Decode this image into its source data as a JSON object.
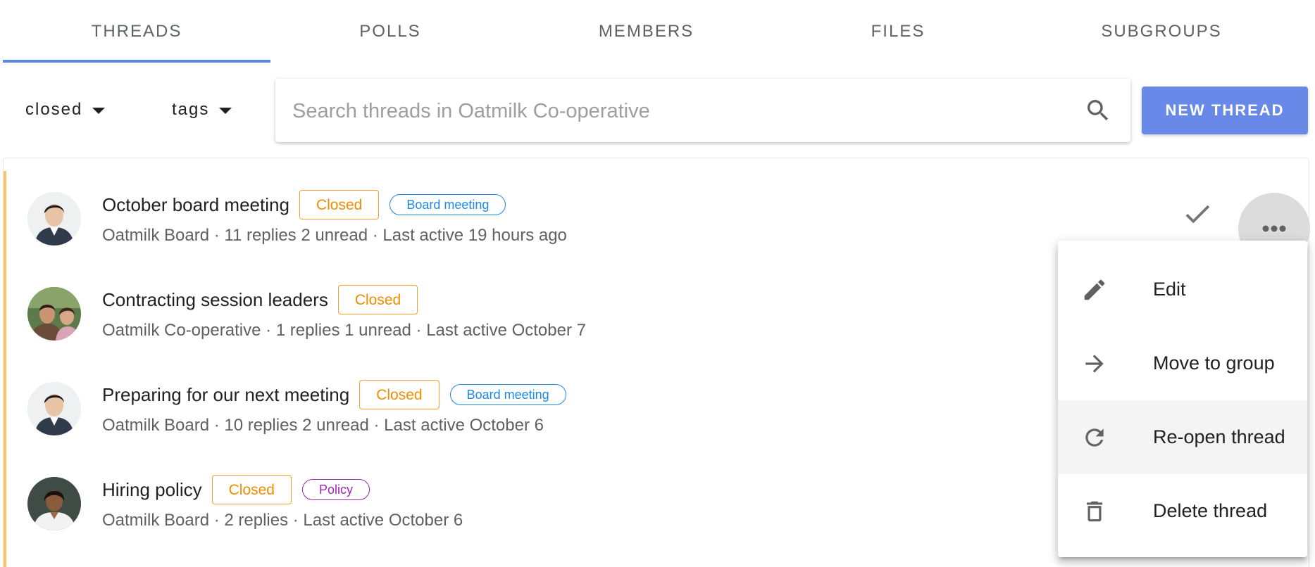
{
  "tabs": [
    {
      "label": "THREADS",
      "active": true
    },
    {
      "label": "POLLS"
    },
    {
      "label": "MEMBERS"
    },
    {
      "label": "FILES"
    },
    {
      "label": "SUBGROUPS"
    }
  ],
  "colors": {
    "accent": "#5b86e5",
    "button": "#6889e8",
    "closed": "#f08c00",
    "unread_bar": "#f7c56d",
    "tag_board": "#1e88e5",
    "tag_policy": "#9c27b0"
  },
  "filters": {
    "status": "closed",
    "tags": "tags"
  },
  "search": {
    "placeholder": "Search threads in Oatmilk Co-operative",
    "icon": "search-icon"
  },
  "new_thread_label": "NEW THREAD",
  "threads": [
    {
      "title": "October board meeting",
      "status": "Closed",
      "tag": "Board meeting",
      "meta": "Oatmilk Board · 11 replies 2 unread · Last active 19 hours ago"
    },
    {
      "title": "Contracting session leaders",
      "status": "Closed",
      "meta": "Oatmilk Co-operative · 1 replies 1 unread · Last active October 7"
    },
    {
      "title": "Preparing for our next meeting",
      "status": "Closed",
      "tag": "Board meeting",
      "meta": "Oatmilk Board · 10 replies 2 unread · Last active October 6"
    },
    {
      "title": "Hiring policy",
      "status": "Closed",
      "tag": "Policy",
      "meta": "Oatmilk Board · 2 replies  · Last active October 6"
    }
  ],
  "menu": [
    {
      "label": "Edit",
      "icon": "pencil-icon"
    },
    {
      "label": "Move to group",
      "icon": "arrow-right-icon"
    },
    {
      "label": "Re-open thread",
      "icon": "refresh-icon",
      "highlighted": true
    },
    {
      "label": "Delete thread",
      "icon": "trash-icon"
    }
  ]
}
